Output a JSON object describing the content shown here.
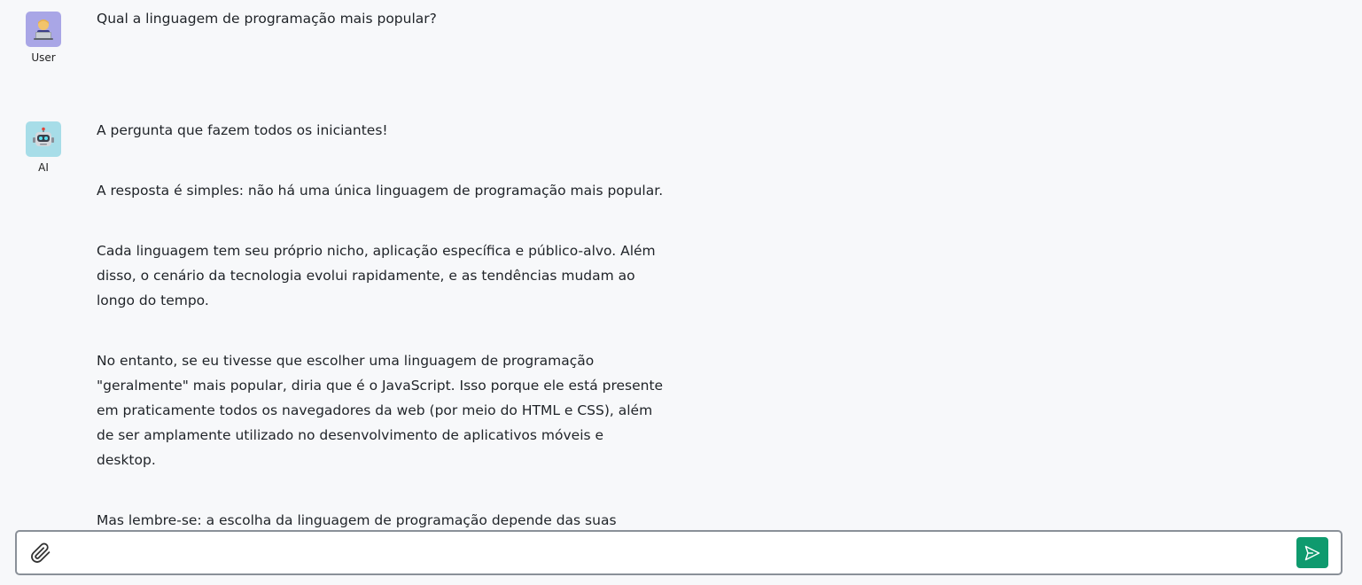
{
  "conversation": {
    "user": {
      "role_label": "User",
      "avatar_icon": "person-laptop-emoji",
      "avatar_bg": "#a9a6e6",
      "message": "Qual a linguagem de programação mais popular?"
    },
    "ai": {
      "role_label": "AI",
      "avatar_icon": "robot-emoji",
      "avatar_bg": "#a7dde8",
      "paragraphs": [
        "A pergunta que fazem todos os iniciantes!",
        "A resposta é simples: não há uma única linguagem de programação mais popular.",
        "Cada linguagem tem seu próprio nicho, aplicação específica e público-alvo. Além disso, o cenário da tecnologia evolui rapidamente, e as tendências mudam ao longo do tempo.",
        "No entanto, se eu tivesse que escolher uma linguagem de programação \"geralmente\" mais popular, diria que é o JavaScript. Isso porque ele está presente em praticamente todos os navegadores da web (por meio do HTML e CSS), além de ser amplamente utilizado no desenvolvimento de aplicativos móveis e desktop.",
        "Mas lembre-se: a escolha da linguagem de programação depende das suas necessidades específicas, do seu projeto e da sua preferência pessoal."
      ]
    }
  },
  "composer": {
    "value": "",
    "placeholder": "",
    "attach_icon": "paperclip-icon",
    "send_icon": "send-icon",
    "send_color": "#0f9a6e"
  }
}
